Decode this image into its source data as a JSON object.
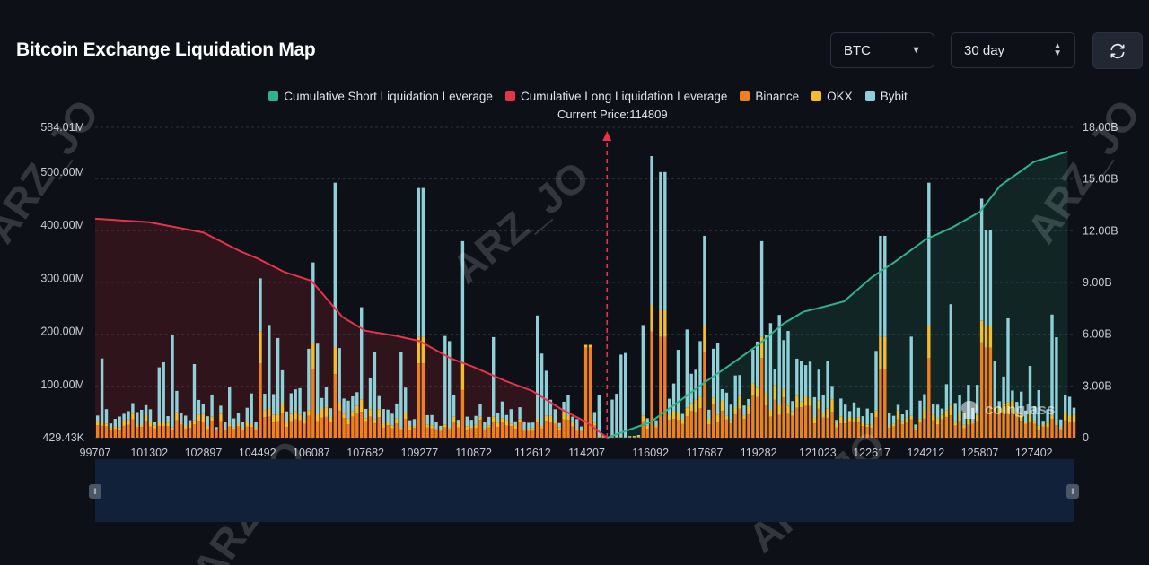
{
  "header": {
    "title": "Bitcoin Exchange Liquidation Map",
    "coin_select": "BTC",
    "period_select": "30 day"
  },
  "colors": {
    "short_cum": "#2fb38d",
    "long_cum": "#e5334b",
    "binance": "#f0801e",
    "okx": "#f5bd26",
    "bybit": "#8ecfd8",
    "background": "#0d1117"
  },
  "icons": {
    "coin_caret": "chevron-down-icon",
    "period_caret": "up-down-icon",
    "refresh": "refresh-icon",
    "zoom_handle": "drag-handle-icon",
    "coinglass": "coinglass-logo"
  },
  "current_price": {
    "label": "Current Price:114809",
    "value": 114809
  },
  "watermark": {
    "brand": "coinglass",
    "overlay": "ARZ_JO"
  },
  "chart_data": {
    "type": "bar",
    "x_tick_labels": [
      "99707",
      "101302",
      "102897",
      "104492",
      "106087",
      "107682",
      "109277",
      "110872",
      "112612",
      "114207",
      "116092",
      "117687",
      "119282",
      "121023",
      "122617",
      "124212",
      "125807",
      "127402"
    ],
    "x_range": [
      99707,
      128600
    ],
    "y_left_tick_labels": [
      "429.43K",
      "100.00M",
      "200.00M",
      "300.00M",
      "400.00M",
      "500.00M",
      "584.01M"
    ],
    "y_left_range": [
      429430,
      584010000
    ],
    "y_right_tick_labels": [
      "0",
      "3.00B",
      "6.00B",
      "9.00B",
      "12.00B",
      "15.00B",
      "18.00B"
    ],
    "y_right_range": [
      0,
      18000000000
    ],
    "grid": true,
    "legend_position": "top-center",
    "series": [
      {
        "name": "Cumulative Short Liquidation Leverage",
        "type": "area",
        "axis": "right"
      },
      {
        "name": "Cumulative Long Liquidation Leverage",
        "type": "area",
        "axis": "right"
      },
      {
        "name": "Binance",
        "type": "bar",
        "axis": "left"
      },
      {
        "name": "OKX",
        "type": "bar",
        "axis": "left"
      },
      {
        "name": "Bybit",
        "type": "bar",
        "axis": "left"
      }
    ],
    "long_cum_points": [
      [
        99707,
        12.7
      ],
      [
        101302,
        12.5
      ],
      [
        102897,
        11.9
      ],
      [
        104000,
        10.8
      ],
      [
        104492,
        10.4
      ],
      [
        105300,
        9.6
      ],
      [
        106087,
        9.1
      ],
      [
        107000,
        7.0
      ],
      [
        107682,
        6.2
      ],
      [
        108600,
        5.9
      ],
      [
        109277,
        5.6
      ],
      [
        110200,
        4.6
      ],
      [
        110872,
        4.1
      ],
      [
        111800,
        3.3
      ],
      [
        112612,
        2.7
      ],
      [
        113500,
        1.6
      ],
      [
        114207,
        0.9
      ],
      [
        114809,
        0.0
      ]
    ],
    "short_cum_points": [
      [
        114809,
        0.0
      ],
      [
        116092,
        0.9
      ],
      [
        117000,
        2.2
      ],
      [
        117687,
        3.2
      ],
      [
        118500,
        4.3
      ],
      [
        119282,
        5.4
      ],
      [
        120000,
        6.6
      ],
      [
        120600,
        7.3
      ],
      [
        121023,
        7.5
      ],
      [
        121800,
        7.9
      ],
      [
        122617,
        9.3
      ],
      [
        123300,
        10.2
      ],
      [
        124212,
        11.5
      ],
      [
        125000,
        12.2
      ],
      [
        125807,
        13.1
      ],
      [
        126400,
        14.6
      ],
      [
        127402,
        16.0
      ],
      [
        128400,
        16.6
      ]
    ],
    "bar_peaks": [
      {
        "x": 104492,
        "binance": 140,
        "okx": 200,
        "bybit": 300
      },
      {
        "x": 106087,
        "binance": 130,
        "okx": 180,
        "bybit": 330
      },
      {
        "x": 106700,
        "binance": 120,
        "okx": 170,
        "bybit": 480
      },
      {
        "x": 109277,
        "binance": 140,
        "okx": 190,
        "bybit": 470
      },
      {
        "x": 110500,
        "binance": 90,
        "okx": 140,
        "bybit": 370
      },
      {
        "x": 114207,
        "binance": 170,
        "okx": 175,
        "bybit": 175
      },
      {
        "x": 116092,
        "binance": 200,
        "okx": 250,
        "bybit": 530
      },
      {
        "x": 116400,
        "binance": 190,
        "okx": 240,
        "bybit": 500
      },
      {
        "x": 117687,
        "binance": 160,
        "okx": 210,
        "bybit": 380
      },
      {
        "x": 119282,
        "binance": 150,
        "okx": 190,
        "bybit": 370
      },
      {
        "x": 122900,
        "binance": 130,
        "okx": 190,
        "bybit": 380
      },
      {
        "x": 124212,
        "binance": 150,
        "okx": 210,
        "bybit": 480
      },
      {
        "x": 125807,
        "binance": 180,
        "okx": 220,
        "bybit": 450
      },
      {
        "x": 126000,
        "binance": 170,
        "okx": 210,
        "bybit": 390
      }
    ]
  }
}
